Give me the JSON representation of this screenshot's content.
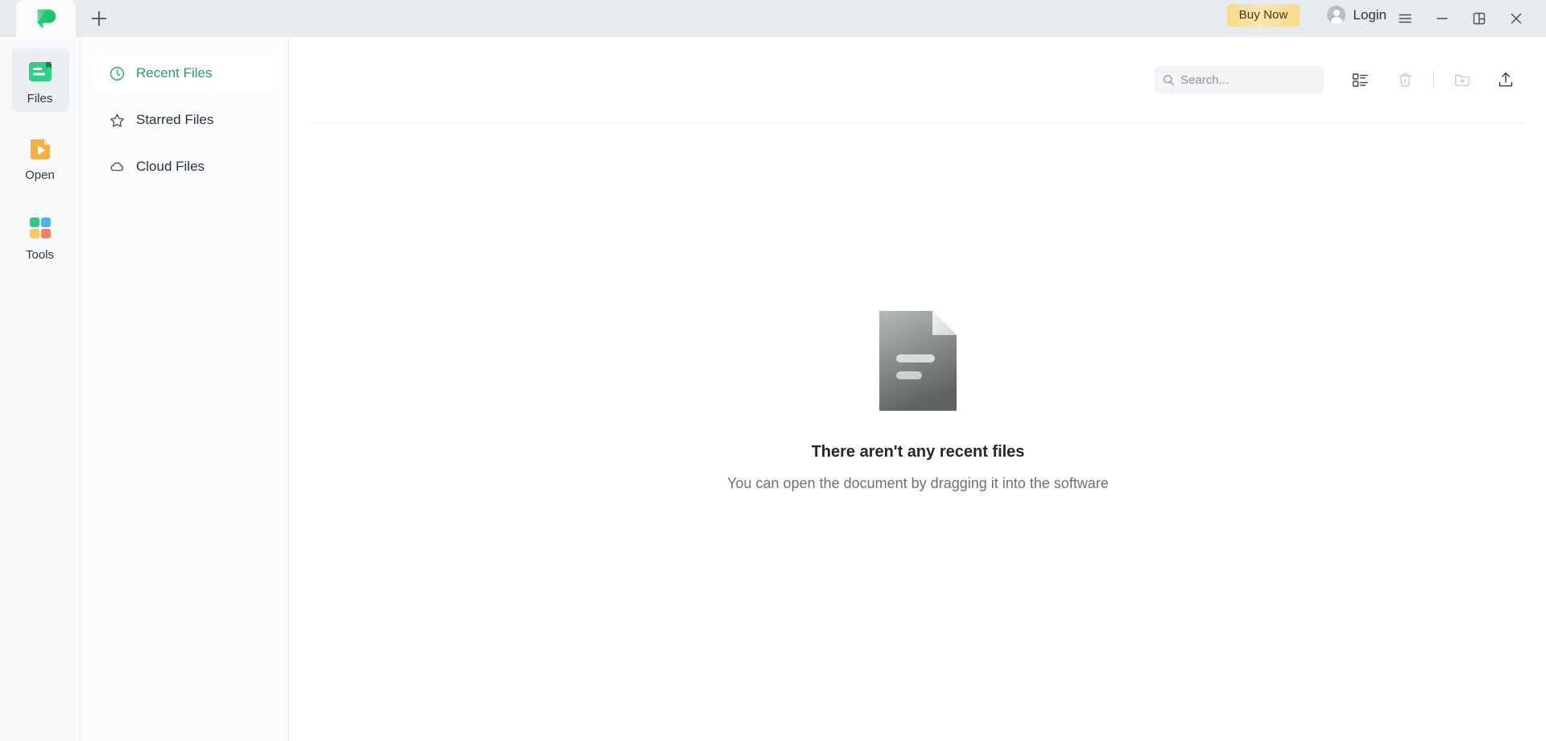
{
  "titlebar": {
    "logo_icon": "app-logo-green-p",
    "new_tab_icon": "plus-icon",
    "buy_now_label": "Buy Now",
    "login_label": "Login",
    "avatar_icon": "user-avatar-icon",
    "menu_icon": "hamburger-menu-icon",
    "minimize_icon": "minimize-icon",
    "restore_icon": "restore-window-icon",
    "close_icon": "close-icon",
    "accent_buy_now": "#f7d98a",
    "background": "#e8ebee"
  },
  "rail": {
    "items": [
      {
        "label": "Files",
        "icon": "files-folder-icon",
        "active": true
      },
      {
        "label": "Open",
        "icon": "open-play-icon",
        "active": false
      },
      {
        "label": "Tools",
        "icon": "tools-grid-icon",
        "active": false
      }
    ]
  },
  "nav": {
    "items": [
      {
        "label": "Recent Files",
        "icon": "clock-icon",
        "active": true
      },
      {
        "label": "Starred Files",
        "icon": "star-icon",
        "active": false
      },
      {
        "label": "Cloud Files",
        "icon": "cloud-icon",
        "active": false
      }
    ],
    "active_color": "#21a366"
  },
  "toolbar": {
    "search_placeholder": "Search...",
    "search_value": "",
    "search_icon": "search-icon",
    "list_view_icon": "list-view-icon",
    "trash_icon": "trash-icon",
    "new_folder_icon": "new-folder-icon",
    "upload_icon": "upload-icon"
  },
  "empty_state": {
    "illustration_icon": "document-placeholder-icon",
    "title": "There aren't any recent files",
    "subtitle": "You can open the document by dragging it into the software"
  }
}
